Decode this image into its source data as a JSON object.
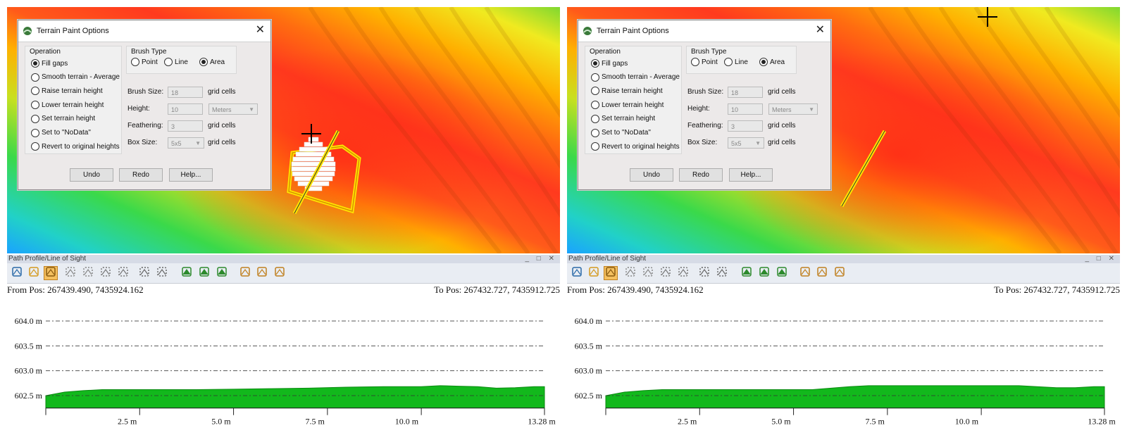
{
  "panes": [
    {
      "dialog": {
        "title": "Terrain Paint Options",
        "operation": {
          "title": "Operation",
          "options": [
            "Fill gaps",
            "Smooth terrain - Average",
            "Raise terrain height",
            "Lower terrain height",
            "Set terrain height",
            "Set to \"NoData\"",
            "Revert to original heights"
          ],
          "selected": 0
        },
        "brush_type": {
          "title": "Brush Type",
          "options": [
            "Point",
            "Line",
            "Area"
          ],
          "selected": 2
        },
        "brush_size": {
          "label": "Brush Size:",
          "value": "18",
          "unit": "grid cells"
        },
        "height": {
          "label": "Height:",
          "value": "10",
          "unit": "Meters"
        },
        "feathering": {
          "label": "Feathering:",
          "value": "3",
          "unit": "grid cells"
        },
        "box_size": {
          "label": "Box Size:",
          "value": "5x5",
          "unit": "grid cells"
        },
        "buttons": {
          "undo": "Undo",
          "redo": "Redo",
          "help": "Help..."
        }
      },
      "panel": {
        "title": "Path Profile/Line of Sight",
        "controls": "_ □ ✕",
        "from_pos": "From Pos: 267439.490, 7435924.162",
        "to_pos": "To Pos: 267432.727, 7435912.725"
      },
      "chart_data": {
        "type": "area",
        "y_ticks": [
          602.5,
          603.0,
          603.5,
          604.0
        ],
        "y_tick_labels": [
          "602.5 m",
          "603.0 m",
          "603.5 m",
          "604.0 m"
        ],
        "x_ticks": [
          2.5,
          5.0,
          7.5,
          10.0,
          13.28
        ],
        "x_tick_labels": [
          "2.5 m",
          "5.0 m",
          "7.5 m",
          "10.0 m",
          "13.28 m"
        ],
        "xlim": [
          0,
          13.28
        ],
        "ylim": [
          602.25,
          604.2
        ],
        "x": [
          0,
          0.5,
          1.0,
          1.5,
          2.0,
          3,
          4,
          5,
          6,
          7,
          8,
          9,
          10,
          10.5,
          11,
          11.5,
          12,
          12.5,
          13,
          13.28
        ],
        "y": [
          602.5,
          602.57,
          602.6,
          602.62,
          602.62,
          602.62,
          602.62,
          602.63,
          602.64,
          602.65,
          602.67,
          602.68,
          602.68,
          602.7,
          602.69,
          602.68,
          602.65,
          602.66,
          602.68,
          602.68
        ],
        "grid": true,
        "fill_color": "#12b81c"
      },
      "colors": {
        "path_line": "#ffe600"
      }
    },
    {
      "dialog": {
        "title": "Terrain Paint Options",
        "operation": {
          "title": "Operation",
          "options": [
            "Fill gaps",
            "Smooth terrain - Average",
            "Raise terrain height",
            "Lower terrain height",
            "Set terrain height",
            "Set to \"NoData\"",
            "Revert to original heights"
          ],
          "selected": 0
        },
        "brush_type": {
          "title": "Brush Type",
          "options": [
            "Point",
            "Line",
            "Area"
          ],
          "selected": 2
        },
        "brush_size": {
          "label": "Brush Size:",
          "value": "18",
          "unit": "grid cells"
        },
        "height": {
          "label": "Height:",
          "value": "10",
          "unit": "Meters"
        },
        "feathering": {
          "label": "Feathering:",
          "value": "3",
          "unit": "grid cells"
        },
        "box_size": {
          "label": "Box Size:",
          "value": "5x5",
          "unit": "grid cells"
        },
        "buttons": {
          "undo": "Undo",
          "redo": "Redo",
          "help": "Help..."
        }
      },
      "panel": {
        "title": "Path Profile/Line of Sight",
        "controls": "_ □ ✕",
        "from_pos": "From Pos: 267439.490, 7435924.162",
        "to_pos": "To Pos: 267432.727, 7435912.725"
      },
      "chart_data": {
        "type": "area",
        "y_ticks": [
          602.5,
          603.0,
          603.5,
          604.0
        ],
        "y_tick_labels": [
          "602.5 m",
          "603.0 m",
          "603.5 m",
          "604.0 m"
        ],
        "x_ticks": [
          2.5,
          5.0,
          7.5,
          10.0,
          13.28
        ],
        "x_tick_labels": [
          "2.5 m",
          "5.0 m",
          "7.5 m",
          "10.0 m",
          "13.28 m"
        ],
        "xlim": [
          0,
          13.28
        ],
        "ylim": [
          602.25,
          604.2
        ],
        "x": [
          0,
          0.5,
          1.0,
          1.5,
          2.0,
          3,
          4,
          5,
          5.5,
          6,
          6.5,
          7,
          7.5,
          8,
          9,
          10,
          11,
          12,
          12.5,
          13,
          13.28
        ],
        "y": [
          602.5,
          602.57,
          602.6,
          602.62,
          602.62,
          602.62,
          602.62,
          602.62,
          602.62,
          602.65,
          602.68,
          602.7,
          602.7,
          602.7,
          602.7,
          602.7,
          602.7,
          602.66,
          602.66,
          602.68,
          602.68
        ],
        "grid": true,
        "fill_color": "#12b81c"
      },
      "colors": {
        "path_line": "#ffe600"
      }
    }
  ]
}
